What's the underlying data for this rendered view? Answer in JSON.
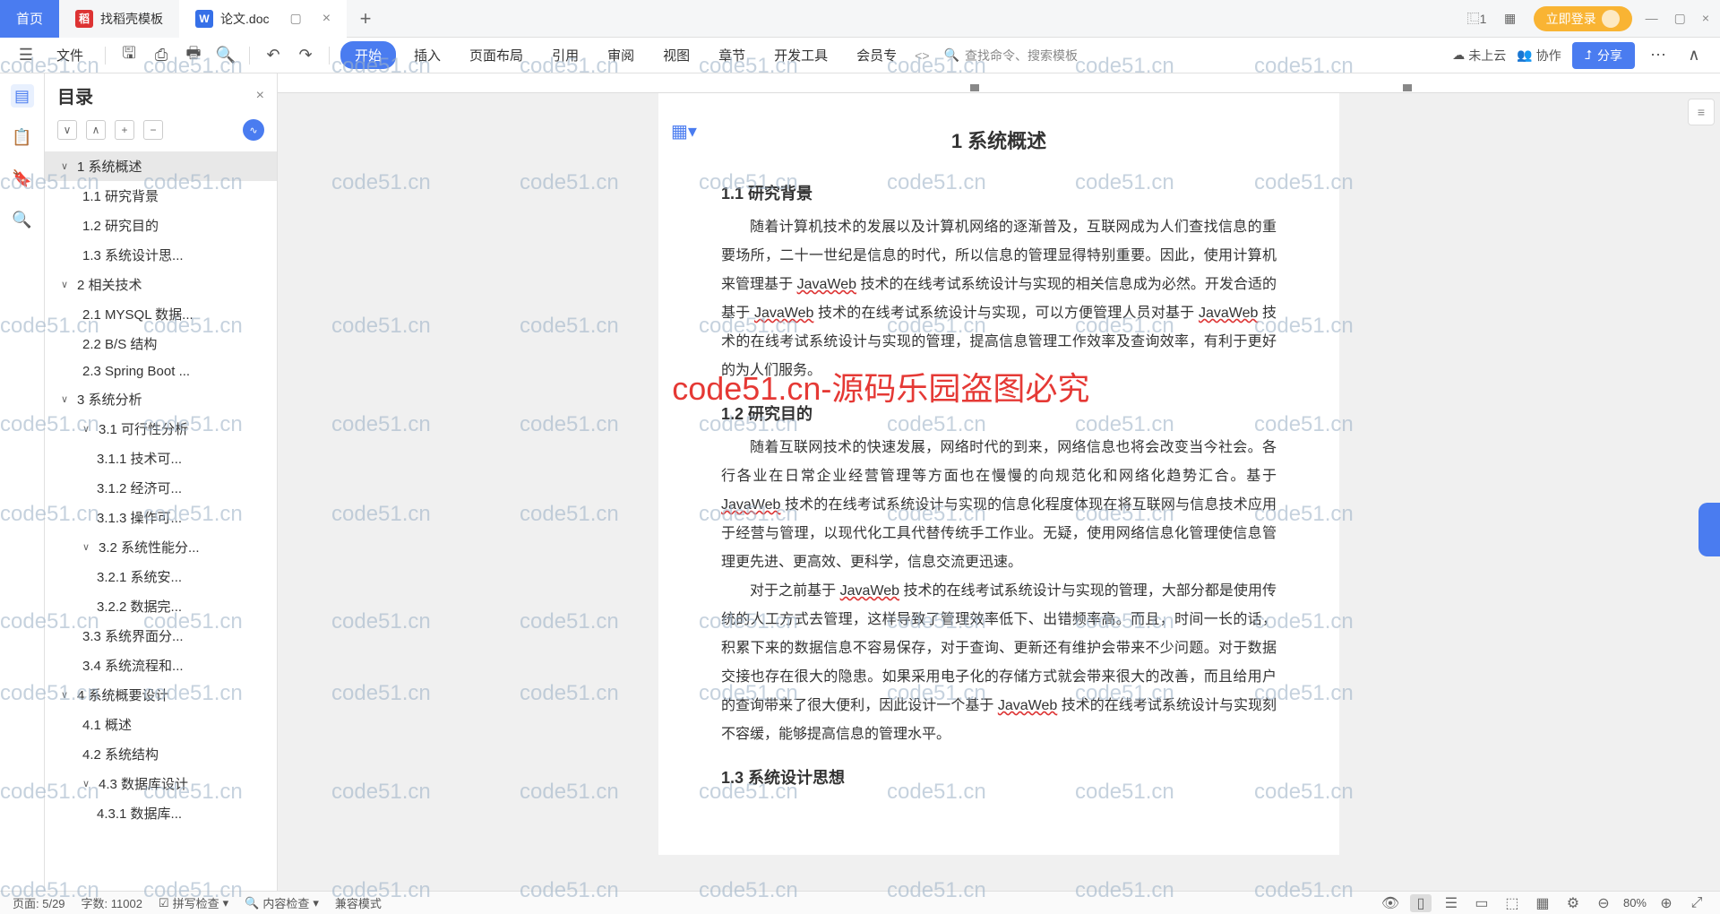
{
  "titlebar": {
    "home": "首页",
    "template_tab": "找稻壳模板",
    "doc_tab": "论文.doc",
    "login": "立即登录"
  },
  "toolbar": {
    "file": "文件",
    "menus": [
      "开始",
      "插入",
      "页面布局",
      "引用",
      "审阅",
      "视图",
      "章节",
      "开发工具",
      "会员专"
    ],
    "search_placeholder": "查找命令、搜索模板",
    "cloud": "未上云",
    "collab": "协作",
    "share": "分享"
  },
  "outline": {
    "title": "目录",
    "items": [
      {
        "l": 1,
        "t": "1 系统概述",
        "c": true,
        "sel": true
      },
      {
        "l": 2,
        "t": "1.1 研究背景"
      },
      {
        "l": 2,
        "t": "1.2 研究目的"
      },
      {
        "l": 2,
        "t": "1.3 系统设计思..."
      },
      {
        "l": 1,
        "t": "2 相关技术",
        "c": true
      },
      {
        "l": 2,
        "t": "2.1 MYSQL 数据..."
      },
      {
        "l": 2,
        "t": "2.2 B/S 结构"
      },
      {
        "l": 2,
        "t": "2.3 Spring Boot ..."
      },
      {
        "l": 1,
        "t": "3 系统分析",
        "c": true
      },
      {
        "l": 2,
        "t": "3.1 可行性分析",
        "c": true
      },
      {
        "l": 3,
        "t": "3.1.1 技术可..."
      },
      {
        "l": 3,
        "t": "3.1.2 经济可..."
      },
      {
        "l": 3,
        "t": "3.1.3 操作可..."
      },
      {
        "l": 2,
        "t": "3.2 系统性能分...",
        "c": true
      },
      {
        "l": 3,
        "t": "3.2.1 系统安..."
      },
      {
        "l": 3,
        "t": "3.2.2 数据完..."
      },
      {
        "l": 2,
        "t": "3.3 系统界面分..."
      },
      {
        "l": 2,
        "t": "3.4 系统流程和..."
      },
      {
        "l": 1,
        "t": "4 系统概要设计",
        "c": true
      },
      {
        "l": 2,
        "t": "4.1 概述"
      },
      {
        "l": 2,
        "t": "4.2 系统结构"
      },
      {
        "l": 2,
        "t": "4.3 数据库设计",
        "c": true
      },
      {
        "l": 3,
        "t": "4.3.1 数据库..."
      }
    ]
  },
  "document": {
    "h1": "1 系统概述",
    "s11_title": "1.1  研究背景",
    "s11_p": "随着计算机技术的发展以及计算机网络的逐渐普及，互联网成为人们查找信息的重要场所，二十一世纪是信息的时代，所以信息的管理显得特别重要。因此，使用计算机来管理基于 JavaWeb 技术的在线考试系统设计与实现的相关信息成为必然。开发合适的基于 JavaWeb 技术的在线考试系统设计与实现，可以方便管理人员对基于 JavaWeb 技术的在线考试系统设计与实现的管理，提高信息管理工作效率及查询效率，有利于更好的为人们服务。",
    "s12_title": "1.2 研究目的",
    "s12_p1": "随着互联网技术的快速发展，网络时代的到来，网络信息也将会改变当今社会。各行各业在日常企业经营管理等方面也在慢慢的向规范化和网络化趋势汇合。基于JavaWeb 技术的在线考试系统设计与实现的信息化程度体现在将互联网与信息技术应用于经营与管理，以现代化工具代替传统手工作业。无疑，使用网络信息化管理使信息管理更先进、更高效、更科学，信息交流更迅速。",
    "s12_p2": "对于之前基于 JavaWeb 技术的在线考试系统设计与实现的管理，大部分都是使用传统的人工方式去管理，这样导致了管理效率低下、出错频率高。而且，时间一长的话，积累下来的数据信息不容易保存，对于查询、更新还有维护会带来不少问题。对于数据交接也存在很大的隐患。如果采用电子化的存储方式就会带来很大的改善，而且给用户的查询带来了很大便利，因此设计一个基于 JavaWeb 技术的在线考试系统设计与实现刻不容缓，能够提高信息的管理水平。",
    "s13_title": "1.3 系统设计思想"
  },
  "statusbar": {
    "page": "页面: 5/29",
    "words": "字数: 11002",
    "spell": "拼写检查",
    "content": "内容检查",
    "compat": "兼容模式",
    "zoom": "80%"
  },
  "overlay": "code51.cn-源码乐园盗图必究",
  "watermark": "code51.cn"
}
